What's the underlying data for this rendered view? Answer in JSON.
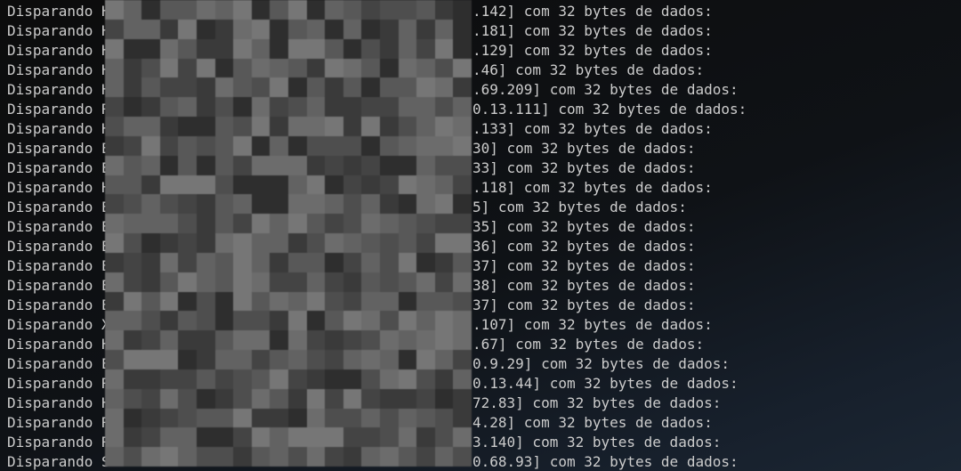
{
  "terminal": {
    "lines": [
      {
        "lead": "Disparando H",
        "tail": ".142] com 32 bytes de dados:"
      },
      {
        "lead": "Disparando H",
        "tail": ".181] com 32 bytes de dados:"
      },
      {
        "lead": "Disparando H",
        "tail": ".129] com 32 bytes de dados:"
      },
      {
        "lead": "Disparando H",
        "tail": ".46] com 32 bytes de dados:"
      },
      {
        "lead": "Disparando H",
        "tail": ".69.209] com 32 bytes de dados:"
      },
      {
        "lead": "Disparando R",
        "tail": "0.13.111] com 32 bytes de dados:"
      },
      {
        "lead": "Disparando H",
        "tail": ".133] com 32 bytes de dados:"
      },
      {
        "lead": "Disparando E",
        "tail": "30] com 32 bytes de dados:"
      },
      {
        "lead": "Disparando E",
        "tail": "33] com 32 bytes de dados:"
      },
      {
        "lead": "Disparando H",
        "tail": ".118] com 32 bytes de dados:"
      },
      {
        "lead": "Disparando E",
        "tail": "5] com 32 bytes de dados:"
      },
      {
        "lead": "Disparando E",
        "tail": "35] com 32 bytes de dados:"
      },
      {
        "lead": "Disparando E",
        "tail": "36] com 32 bytes de dados:"
      },
      {
        "lead": "Disparando E",
        "tail": "37] com 32 bytes de dados:"
      },
      {
        "lead": "Disparando E",
        "tail": "38] com 32 bytes de dados:"
      },
      {
        "lead": "Disparando E",
        "tail": "37] com 32 bytes de dados:"
      },
      {
        "lead": "Disparando X",
        "tail": ".107] com 32 bytes de dados:"
      },
      {
        "lead": "Disparando H",
        "tail": ".67] com 32 bytes de dados:"
      },
      {
        "lead": "Disparando E",
        "tail": "0.9.29] com 32 bytes de dados:"
      },
      {
        "lead": "Disparando R",
        "tail": "0.13.44] com 32 bytes de dados:"
      },
      {
        "lead": "Disparando H",
        "tail": "72.83] com 32 bytes de dados:"
      },
      {
        "lead": "Disparando R",
        "tail": "4.28] com 32 bytes de dados:"
      },
      {
        "lead": "Disparando R",
        "tail": "3.140] com 32 bytes de dados:"
      },
      {
        "lead": "Disparando S",
        "tail": "0.68.93] com 32 bytes de dados:"
      }
    ]
  },
  "colors": {
    "background": "#0c0c0c",
    "text": "#cccccc",
    "redaction_shades": [
      "#2e2e2e",
      "#3a3a3a",
      "#444444",
      "#4e4e4e",
      "#585858",
      "#626262",
      "#6c6c6c",
      "#767676"
    ]
  }
}
